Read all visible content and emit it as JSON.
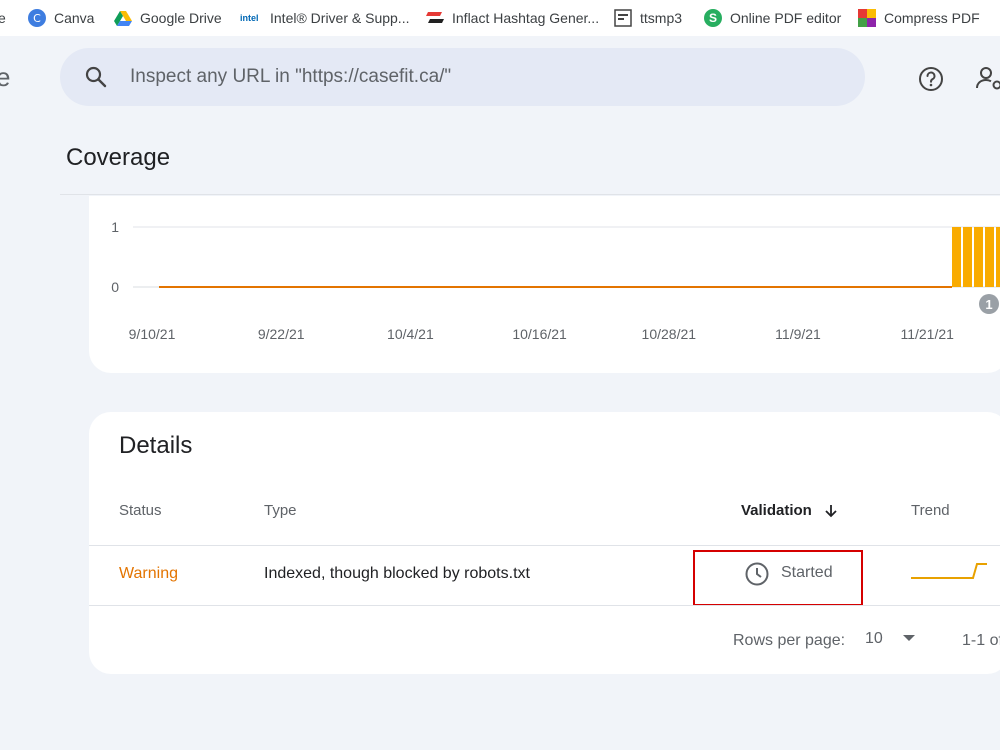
{
  "bookmarks": [
    {
      "label": "e",
      "icon": "truncated-bookmark-icon"
    },
    {
      "label": "Canva",
      "icon": "canva-icon"
    },
    {
      "label": "Google Drive",
      "icon": "google-drive-icon"
    },
    {
      "label": "Intel® Driver & Supp...",
      "icon": "intel-icon",
      "icon_text": "intel"
    },
    {
      "label": "Inflact Hashtag Gener...",
      "icon": "inflact-icon"
    },
    {
      "label": "ttsmp3",
      "icon": "ttsmp3-icon"
    },
    {
      "label": "Online PDF editor",
      "icon": "sejda-icon",
      "icon_text": "S"
    },
    {
      "label": "Compress PDF",
      "icon": "compress-pdf-icon"
    }
  ],
  "nav": {
    "partial_title": "e"
  },
  "search": {
    "placeholder": "Inspect any URL in \"https://casefit.ca/\""
  },
  "page_title": "Coverage",
  "chart_data": {
    "type": "bar",
    "x_ticks": [
      "9/10/21",
      "9/22/21",
      "10/4/21",
      "10/16/21",
      "10/28/21",
      "11/9/21",
      "11/21/21"
    ],
    "y_ticks": [
      "1",
      "0"
    ],
    "ylim": [
      0,
      1
    ],
    "values_before": 0,
    "values_after": 1,
    "bar_color": "#f9ab00",
    "line_color": "#e37400",
    "annotation": "1"
  },
  "details": {
    "title": "Details",
    "columns": {
      "status": "Status",
      "type": "Type",
      "validation": "Validation",
      "trend": "Trend"
    },
    "rows": [
      {
        "status": "Warning",
        "type": "Indexed, though blocked by robots.txt",
        "validation": "Started"
      }
    ],
    "footer": {
      "rows_per_page_label": "Rows per page:",
      "rows_per_page_value": "10",
      "range": "1-1 of"
    }
  },
  "colors": {
    "warning": "#e37400",
    "highlight": "#d50000",
    "accent": "#f9ab00"
  }
}
